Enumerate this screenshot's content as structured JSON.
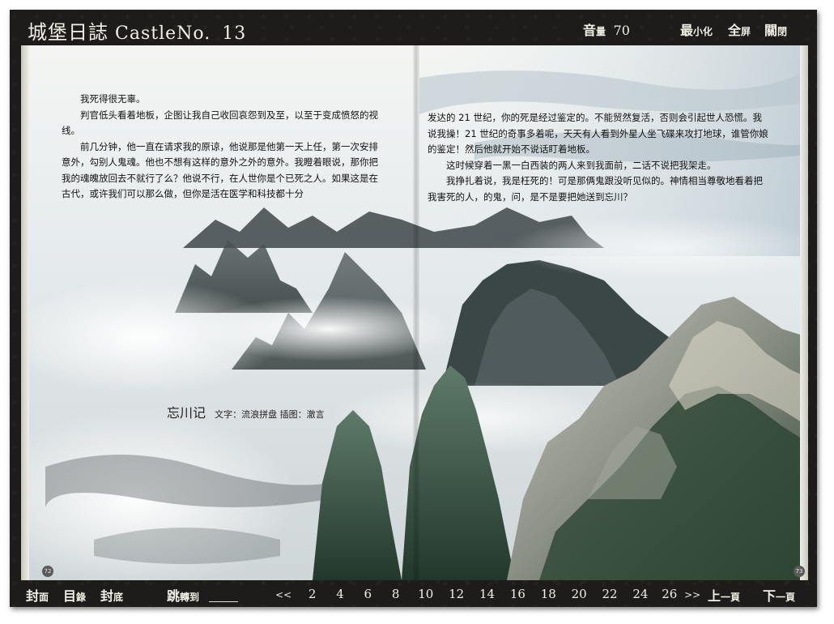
{
  "header": {
    "title_cn": "城堡日誌",
    "title_en": "CastleNo.",
    "issue": "13",
    "volume": {
      "label_big": "音",
      "label_small": "量",
      "value": "70"
    },
    "minimize": {
      "big": "最",
      "small": "小化"
    },
    "fullscreen": {
      "big": "全",
      "small": "屏"
    },
    "close": {
      "big": "關",
      "small": "閉"
    }
  },
  "left_page": {
    "paragraphs": [
      "我死得很无辜。",
      "判官低头看着地板，企图让我自己收回哀怨到及至，以至于变成愤怒的视线。",
      "前几分钟，他一直在请求我的原谅，他说那是他第一天上任，第一次安排意外，勾别人鬼魂。他也不想有这样的意外之外的意外。我瞪着眼说，那你把我的魂魄放回去不就行了么？他说不行，在人世你是个已死之人。如果这是在古代，或许我们可以那么做，但你是活在医学和科技都十分"
    ],
    "page_number": "72"
  },
  "right_page": {
    "paragraphs": [
      "发达的 21 世纪，你的死是经过鉴定的。不能贸然复活，否则会引起世人恐慌。我说我操！21 世纪的奇事多着呢，天天有人看到外星人坐飞碟来攻打地球，谁管你娘的鉴定！然后他就开始不说话盯着地板。",
      "这时候穿着一黑一白西装的两人来到我面前，二话不说把我架走。",
      "我挣扎着说，我是枉死的！可是那俩鬼跟没听见似的。神情相当尊敬地看着把我害死的人，的鬼，问，是不是要把她送到忘川？"
    ],
    "page_number": "73"
  },
  "caption": {
    "title": "忘川记",
    "credit": "文字：流浪拼盘  插图：澈言"
  },
  "footer": {
    "cover": {
      "big": "封",
      "small": "面"
    },
    "toc": {
      "big": "目",
      "small": "錄"
    },
    "back": {
      "big": "封",
      "small": "底"
    },
    "jump": {
      "big": "跳",
      "small": "轉到"
    },
    "prev_arrows": "<<",
    "pages": [
      "2",
      "4",
      "6",
      "8",
      "10",
      "12",
      "14",
      "16",
      "18",
      "20",
      "22",
      "24",
      "26"
    ],
    "next_arrows": ">>",
    "prev_page": {
      "big": "上",
      "small": "一頁"
    },
    "next_page": {
      "big": "下",
      "small": "一頁"
    }
  }
}
